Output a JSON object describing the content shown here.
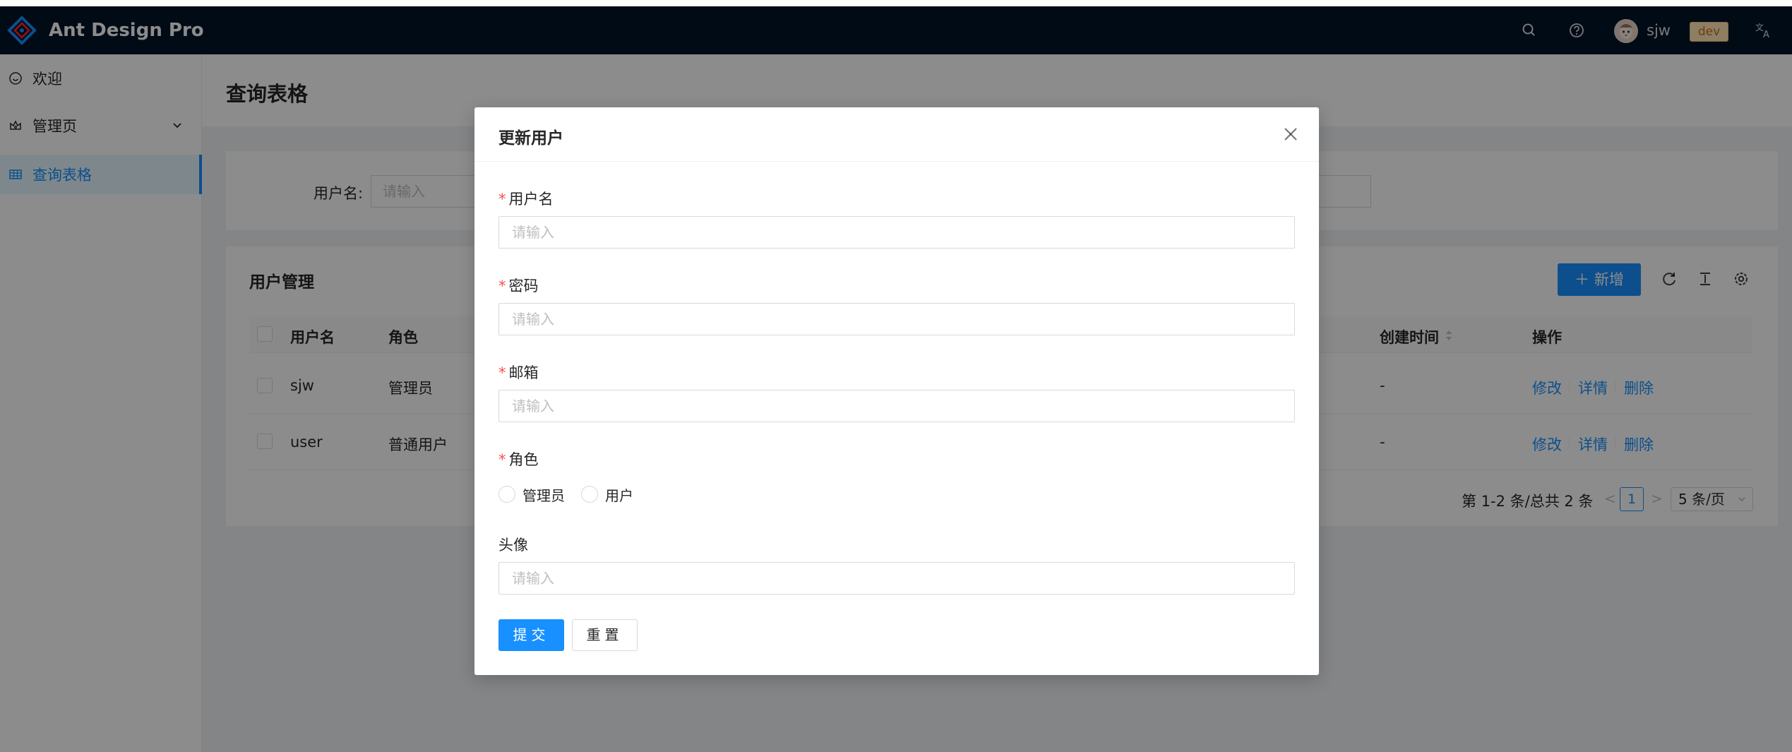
{
  "header": {
    "app_title": "Ant Design Pro",
    "username": "sjw",
    "env_tag": "dev",
    "icons": [
      "logo-icon",
      "search-icon",
      "question-icon",
      "avatar",
      "translate-icon"
    ]
  },
  "sidebar": {
    "items": [
      {
        "label": "欢迎",
        "icon": "smile-icon"
      },
      {
        "label": "管理页",
        "icon": "crown-icon"
      },
      {
        "label": "查询表格",
        "icon": "table-icon"
      }
    ]
  },
  "page": {
    "title": "查询表格",
    "search_label": "用户名:",
    "search_placeholder": "请输入"
  },
  "table": {
    "title": "用户管理",
    "new_button": "新增",
    "columns": [
      "用户名",
      "角色",
      "创建时间",
      "操作"
    ],
    "rows": [
      {
        "username": "sjw",
        "role": "管理员",
        "created": "-",
        "actions": [
          "修改",
          "详情",
          "删除"
        ]
      },
      {
        "username": "user",
        "role": "普通用户",
        "created": "-",
        "actions": [
          "修改",
          "详情",
          "删除"
        ]
      }
    ],
    "pager": {
      "total_text": "第 1-2 条/总共 2 条",
      "prev": "<",
      "current": "1",
      "next": ">",
      "page_size": "5 条/页"
    }
  },
  "modal": {
    "title": "更新用户",
    "fields": {
      "username": {
        "label": "用户名",
        "required": "*",
        "placeholder": "请输入"
      },
      "password": {
        "label": "密码",
        "required": "*",
        "placeholder": "请输入"
      },
      "email": {
        "label": "邮箱",
        "required": "*",
        "placeholder": "请输入"
      },
      "role": {
        "label": "角色",
        "required": "*",
        "options": [
          "管理员",
          "用户"
        ]
      },
      "avatar": {
        "label": "头像",
        "placeholder": "请输入"
      }
    },
    "submit_label": "提交",
    "reset_label": "重置"
  },
  "colors": {
    "header_bg": "#001529",
    "primary": "#1890ff",
    "required": "#ff4d4f",
    "env_tag": "#ffe7ba"
  }
}
